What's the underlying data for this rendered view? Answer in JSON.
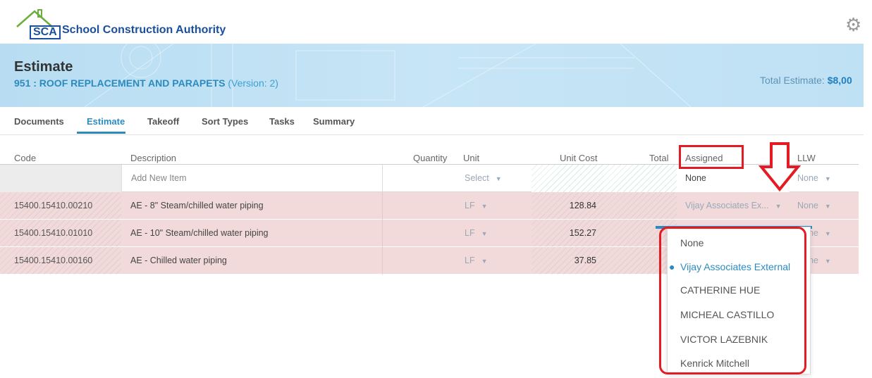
{
  "header": {
    "logo_text": "SCA",
    "logo_subtext": "School Construction Authority",
    "org_name": "School Construction Authority",
    "settings_icon": "gear-icon"
  },
  "banner": {
    "title": "Estimate",
    "project": "951 : ROOF REPLACEMENT AND PARAPETS",
    "version": "(Version: 2)",
    "total_label": "Total Estimate:",
    "total_value": "$8,00"
  },
  "tabs": [
    {
      "label": "Documents",
      "active": false
    },
    {
      "label": "Estimate",
      "active": true
    },
    {
      "label": "Takeoff",
      "active": false
    },
    {
      "label": "Sort Types",
      "active": false
    },
    {
      "label": "Tasks",
      "active": false
    },
    {
      "label": "Summary",
      "active": false
    }
  ],
  "table": {
    "columns": {
      "code": "Code",
      "description": "Description",
      "quantity": "Quantity",
      "unit": "Unit",
      "unit_cost": "Unit Cost",
      "total": "Total",
      "assigned": "Assigned",
      "llw": "LLW"
    },
    "add_row": {
      "description_placeholder": "Add New Item",
      "unit": "Select",
      "assigned": "None",
      "llw": "None"
    },
    "rows": [
      {
        "code": "15400.15410.00210",
        "description": "AE - 8\" Steam/chilled water piping",
        "unit": "LF",
        "unit_cost": "128.84",
        "assigned": "Vijay Associates Ex...",
        "llw": "None"
      },
      {
        "code": "15400.15410.01010",
        "description": "AE - 10\" Steam/chilled water piping",
        "unit": "LF",
        "unit_cost": "152.27",
        "llw": "None"
      },
      {
        "code": "15400.15410.00160",
        "description": "AE - Chilled water piping",
        "unit": "LF",
        "unit_cost": "37.85",
        "llw": "None"
      }
    ]
  },
  "assigned_dropdown": {
    "options": [
      "None",
      "Vijay Associates External",
      "CATHERINE HUE",
      "MICHEAL CASTILLO",
      "VICTOR LAZEBNIK",
      "Kenrick Mitchell"
    ],
    "selected": "Vijay Associates External"
  },
  "colors": {
    "accent": "#2b8bbf",
    "annotation_red": "#e41b23",
    "row_highlight": "#f2dada",
    "banner": "#c0e2f5"
  }
}
